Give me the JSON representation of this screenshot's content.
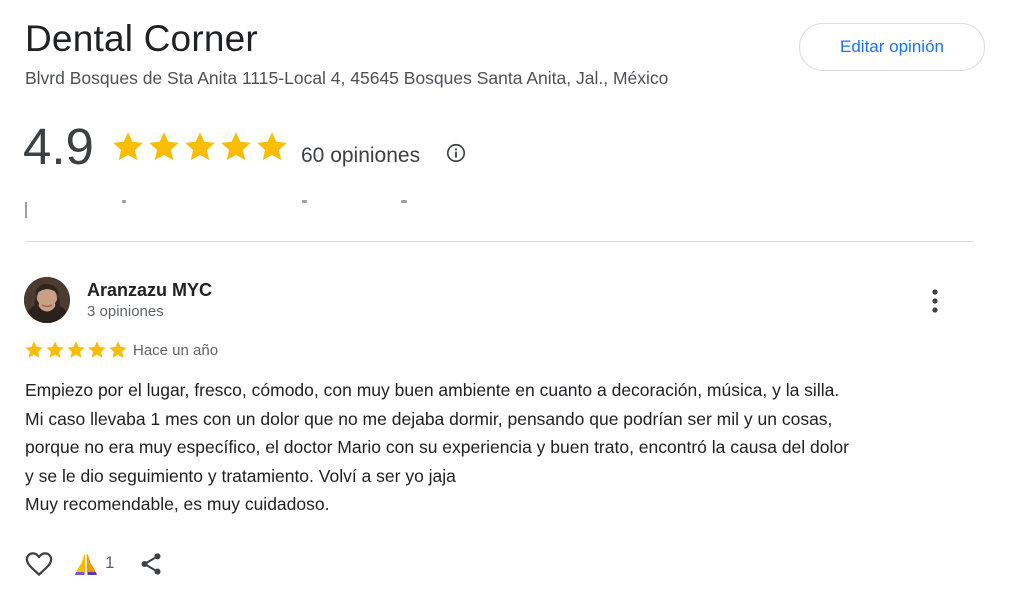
{
  "place": {
    "name": "Dental Corner",
    "address": "Blvrd Bosques de Sta Anita 1115-Local 4, 45645 Bosques Santa Anita, Jal., México",
    "edit_label": "Editar opinión"
  },
  "rating": {
    "value": "4.9",
    "stars": 5,
    "count_label": "60 opiniones"
  },
  "review": {
    "author": "Aranzazu MYC",
    "author_reviews": "3 opiniones",
    "stars": 5,
    "time_ago": "Hace un año",
    "lines": [
      "Empiezo por el lugar, fresco, cómodo, con muy buen ambiente en cuanto a decoración, música, y la silla.",
      "Mi caso llevaba 1 mes con un dolor que no me dejaba dormir, pensando que podrían ser mil y un cosas,",
      "porque no era muy específico, el doctor Mario con su experiencia y buen trato, encontró la causa del dolor",
      "y se le dio seguimiento y tratamiento. Volví a ser yo jaja",
      "Muy recomendable, es muy cuidadoso."
    ],
    "reaction_count": "1"
  },
  "colors": {
    "star": "#fbbc04",
    "accent": "#1a73e8",
    "text": "#202124",
    "muted": "#5f6368",
    "divider": "#dadce0"
  },
  "icons": {
    "info": "info-icon",
    "more": "more-vert-icon",
    "like": "heart-outline-icon",
    "reaction": "thanks-hands-icon",
    "share": "share-icon"
  }
}
